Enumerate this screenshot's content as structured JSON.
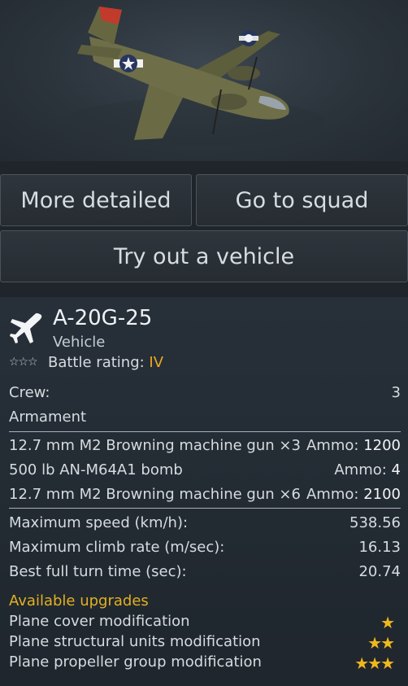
{
  "buttons": {
    "more_detailed": "More detailed",
    "go_to_squad": "Go to squad",
    "try_vehicle": "Try out a vehicle"
  },
  "vehicle": {
    "name": "A-20G-25",
    "type": "Vehicle",
    "rating_stars": "☆☆☆",
    "battle_rating_label": "Battle rating:",
    "battle_rating_value": "IV"
  },
  "crew": {
    "label": "Crew:",
    "value": "3"
  },
  "armament": {
    "title": "Armament",
    "items": [
      {
        "name": "12.7 mm M2 Browning machine gun ×3",
        "ammo_label": "Ammo:",
        "ammo": "1200"
      },
      {
        "name": "500 lb AN-M64A1 bomb",
        "ammo_label": "Ammo:",
        "ammo": "4"
      },
      {
        "name": "12.7 mm M2 Browning machine gun ×6",
        "ammo_label": "Ammo:",
        "ammo": "2100"
      }
    ]
  },
  "stats": [
    {
      "label": "Maximum speed (km/h):",
      "value": "538.56"
    },
    {
      "label": "Maximum climb rate (m/sec):",
      "value": "16.13"
    },
    {
      "label": "Best full turn time (sec):",
      "value": "20.74"
    }
  ],
  "upgrades": {
    "title": "Available upgrades",
    "items": [
      {
        "name": "Plane cover modification",
        "stars": 1
      },
      {
        "name": "Plane structural units modification",
        "stars": 2
      },
      {
        "name": "Plane propeller group modification",
        "stars": 3
      }
    ]
  },
  "colors": {
    "accent": "#f0a81e",
    "upgrade_title": "#e3b020",
    "star": "#f0b81e"
  },
  "icons": {
    "vehicle_icon": "plane-silhouette-icon"
  }
}
